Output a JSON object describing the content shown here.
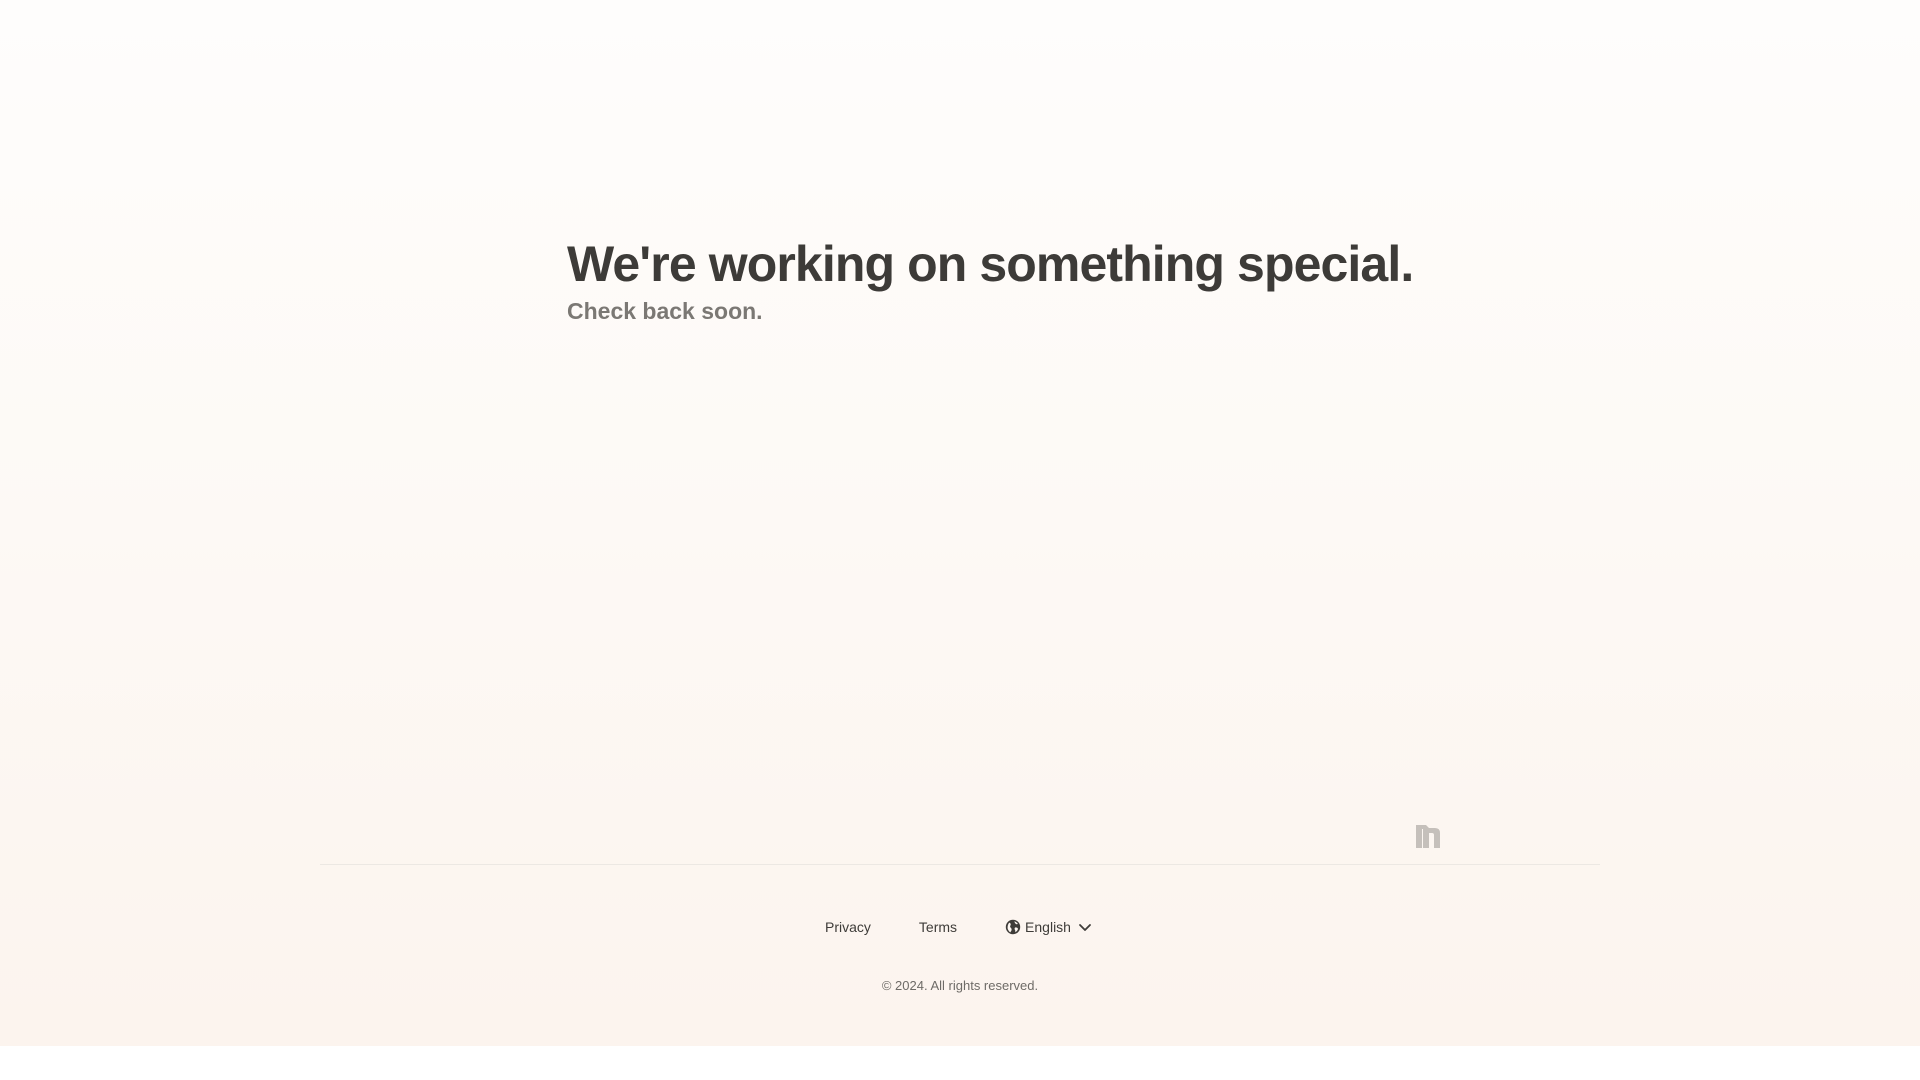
{
  "hero": {
    "title": "We're working on something special.",
    "subtitle": "Check back soon."
  },
  "brand": {
    "icon": "brand-logo-icon",
    "color": "#c5c0bb"
  },
  "footer": {
    "links": [
      {
        "label": "Privacy"
      },
      {
        "label": "Terms"
      }
    ],
    "language": {
      "icon": "globe-icon",
      "value": "English",
      "chevron": "chevron-down-icon"
    },
    "copyright": "© 2024. All rights reserved."
  },
  "colors": {
    "heading": "#3d3b38",
    "subheading": "#7b7874",
    "background_top": "#fefdfc",
    "background_bottom": "#fcf4ee"
  }
}
